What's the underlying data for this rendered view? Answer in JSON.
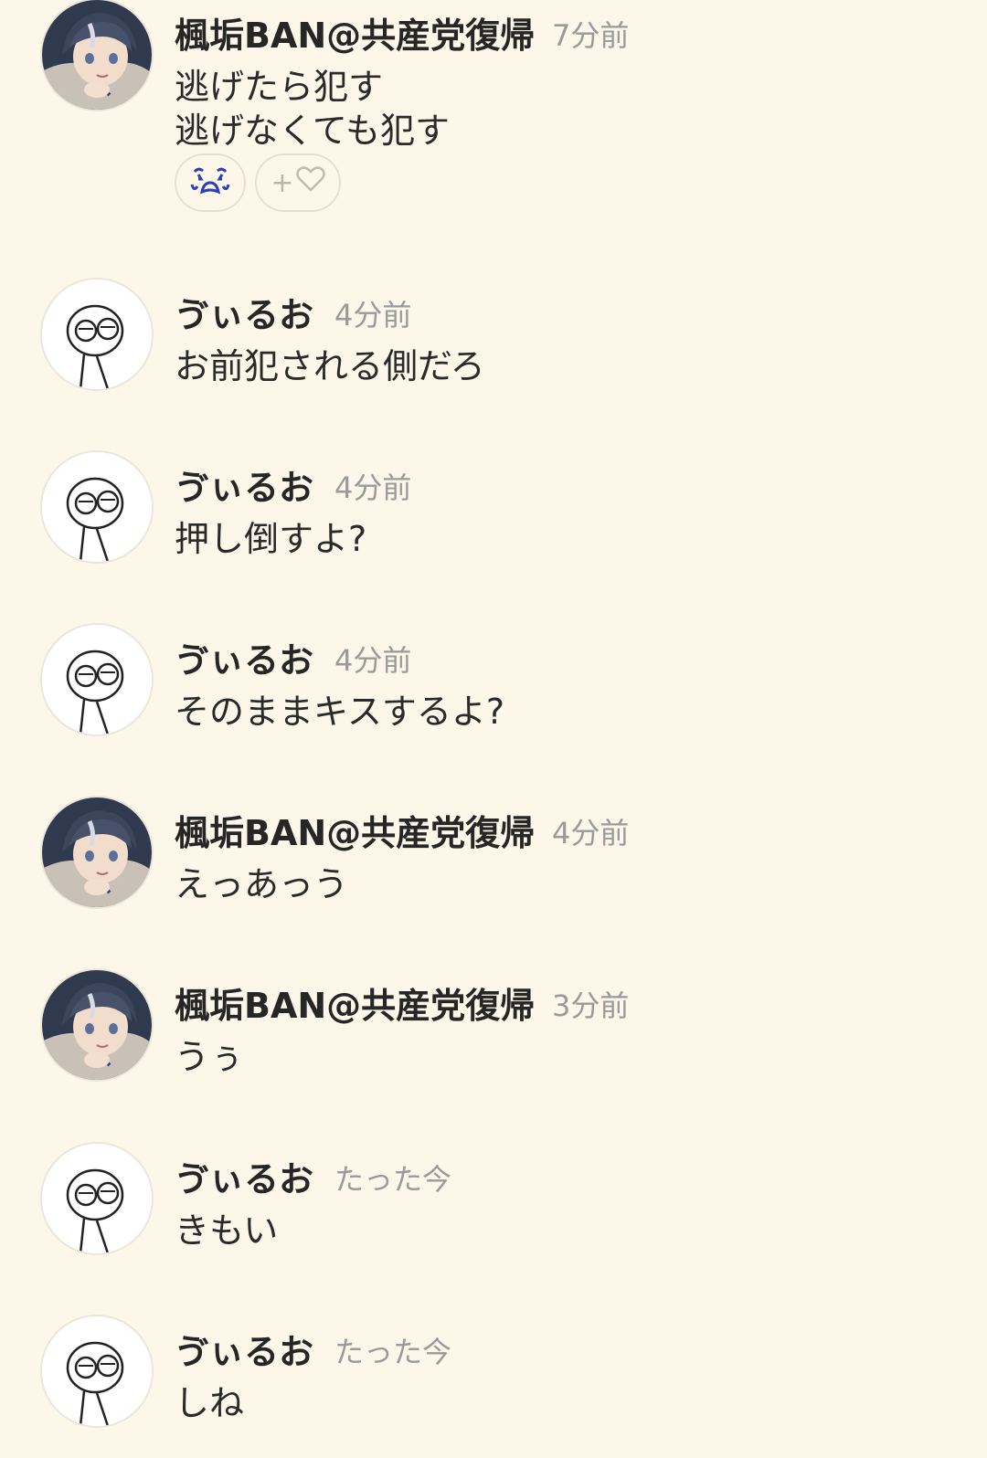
{
  "messages": [
    {
      "user": "楓垢BAN@共産党復帰",
      "time": "7分前",
      "avatar": "anime-avatar",
      "lines": [
        "逃げたら犯す",
        "逃げなくても犯す"
      ],
      "reactions": {
        "emoji": "crying-face-icon",
        "add_label": "+",
        "add_icon": "heart-outline-icon"
      }
    },
    {
      "user": "ゔぃるお",
      "time": "4分前",
      "avatar": "sketch-avatar",
      "lines": [
        "お前犯される側だろ"
      ]
    },
    {
      "user": "ゔぃるお",
      "time": "4分前",
      "avatar": "sketch-avatar",
      "lines": [
        "押し倒すよ?"
      ]
    },
    {
      "user": "ゔぃるお",
      "time": "4分前",
      "avatar": "sketch-avatar",
      "lines": [
        "そのままキスするよ?"
      ]
    },
    {
      "user": "楓垢BAN@共産党復帰",
      "time": "4分前",
      "avatar": "anime-avatar",
      "lines": [
        "えっあっう"
      ]
    },
    {
      "user": "楓垢BAN@共産党復帰",
      "time": "3分前",
      "avatar": "anime-avatar",
      "lines": [
        "うぅ"
      ]
    },
    {
      "user": "ゔぃるお",
      "time": "たった今",
      "avatar": "sketch-avatar",
      "lines": [
        "きもい"
      ]
    },
    {
      "user": "ゔぃるお",
      "time": "たった今",
      "avatar": "sketch-avatar",
      "lines": [
        "しね"
      ]
    }
  ],
  "colors": {
    "background": "#fdf7ea",
    "name": "#262626",
    "time": "#9a9a9a",
    "reaction_emoji": "#2a3fb8"
  }
}
